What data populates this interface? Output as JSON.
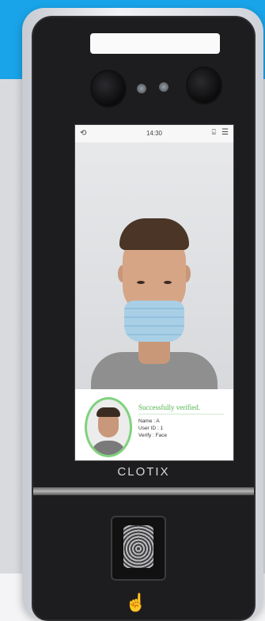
{
  "screen": {
    "status_bar": {
      "back_icon": "back-arrow-icon",
      "time": "14:30",
      "camera_icon": "camera-icon",
      "menu_icon": "menu-icon"
    },
    "result": {
      "title": "Successfully verified.",
      "name_line": "Name : A",
      "user_id_line": "User ID : 1",
      "verify_line": "Verify : Face"
    }
  },
  "device": {
    "brand": "CLOTIX",
    "accent_color": "#19a3e8",
    "verified_color": "#4fb34b"
  }
}
